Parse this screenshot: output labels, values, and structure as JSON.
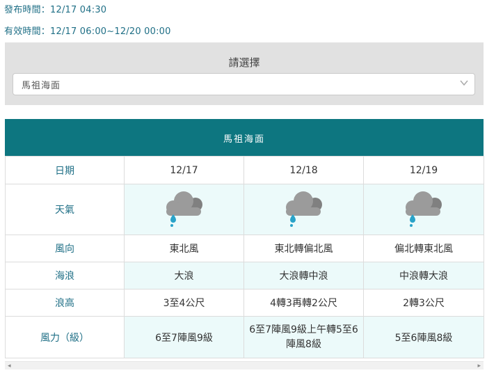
{
  "header": {
    "issued_label": "發布時間：12/17 04:30",
    "valid_label": "有效時間：12/17 06:00~12/20 00:00"
  },
  "selector": {
    "title": "請選擇",
    "selected": "馬祖海面"
  },
  "table": {
    "title": "馬祖海面",
    "row_labels": [
      "日期",
      "天氣",
      "風向",
      "海浪",
      "浪高",
      "風力（級）"
    ],
    "days": [
      {
        "date": "12/17",
        "weather_icon": "rain-cloud-icon",
        "wind_dir": "東北風",
        "wave": "大浪",
        "wave_height": "3至4公尺",
        "wind_force": "6至7陣風9級"
      },
      {
        "date": "12/18",
        "weather_icon": "rain-cloud-icon",
        "wind_dir": "東北轉偏北風",
        "wave": "大浪轉中浪",
        "wave_height": "4轉3再轉2公尺",
        "wind_force": "6至7陣風9級上午轉5至6陣風8級"
      },
      {
        "date": "12/19",
        "weather_icon": "rain-cloud-icon",
        "wind_dir": "偏北轉東北風",
        "wave": "中浪轉大浪",
        "wave_height": "2轉3公尺",
        "wind_force": "5至6陣風8級"
      }
    ]
  },
  "colors": {
    "accent": "#0d7680",
    "label_text": "#1f6f86",
    "alt_row": "#ecfafa",
    "cloud": "#9b9b9b",
    "drop": "#2aa3c9"
  }
}
